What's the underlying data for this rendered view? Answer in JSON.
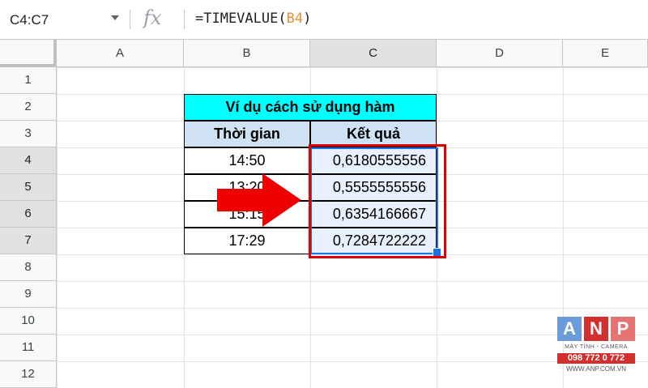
{
  "formula_bar": {
    "name_box": "C4:C7",
    "fx": "fx",
    "formula_prefix": "=TIMEVALUE(",
    "formula_ref": "B4",
    "formula_suffix": ")"
  },
  "columns": [
    "A",
    "B",
    "C",
    "D",
    "E"
  ],
  "rows": [
    "1",
    "2",
    "3",
    "4",
    "5",
    "6",
    "7",
    "8",
    "9",
    "10",
    "11",
    "12"
  ],
  "table": {
    "title": "Ví dụ cách sử dụng hàm",
    "header_time": "Thời gian",
    "header_result": "Kết quả",
    "times": [
      "14:50",
      "13:20",
      "15:15",
      "17:29"
    ],
    "results": [
      "0,6180555556",
      "0,5555555556",
      "0,6354166667",
      "0,7284722222"
    ]
  },
  "colors": {
    "title_bg": "#00ffff",
    "header_bg": "#cfe2f3",
    "selection": "#1a73e8",
    "highlight_box": "#e00000",
    "arrow": "#ee0000"
  },
  "logo": {
    "letters": [
      "A",
      "N",
      "P"
    ],
    "tagline": "MÁY TÍNH - CAMERA",
    "phone": "098 772 0 772",
    "website": "WWW.ANP.COM.VN"
  }
}
